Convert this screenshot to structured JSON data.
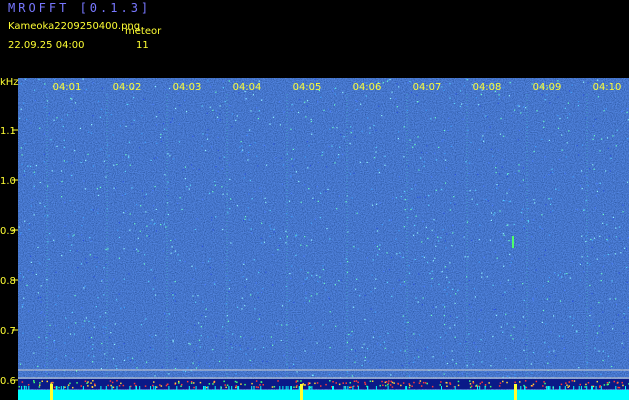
{
  "header": {
    "app_title": "MROFFT [0.1.3]",
    "file_name": "Kameoka2209250400.png",
    "meteor_label": "meteor",
    "timestamp": "22.09.25 04:00",
    "meteor_count": "11"
  },
  "spectrogram": {
    "y_unit": "kHz",
    "y_ticks": [
      "1.1",
      "1.0",
      "0.9",
      "0.8",
      "0.7",
      "0.6"
    ],
    "time_ticks": [
      "04:01",
      "04:02",
      "04:03",
      "04:04",
      "04:05",
      "04:06",
      "04:07",
      "04:08",
      "04:09",
      "04:10"
    ]
  },
  "colors": {
    "title": "#7777ff",
    "text": "#ffff33",
    "background": "#000000",
    "noise_base": "#1b2fa6",
    "baseline": "#00ffff"
  }
}
